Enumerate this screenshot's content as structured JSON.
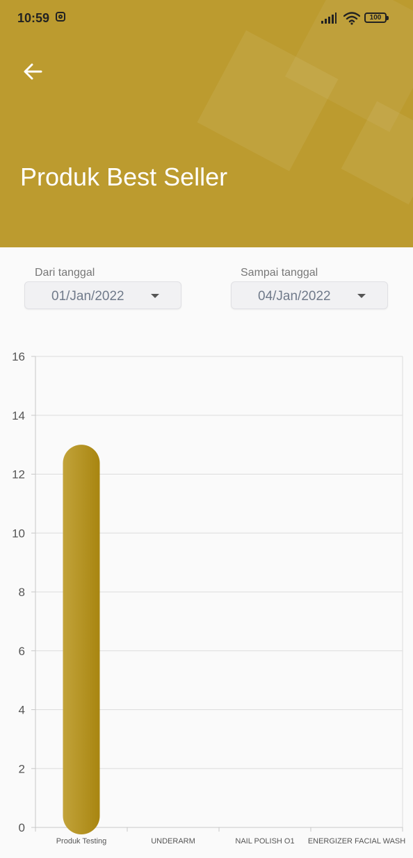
{
  "status_bar": {
    "time": "10:59",
    "battery": "100"
  },
  "header": {
    "title": "Produk Best Seller"
  },
  "filters": {
    "from": {
      "label": "Dari tanggal",
      "value": "01/Jan/2022"
    },
    "to": {
      "label": "Sampai tanggal",
      "value": "04/Jan/2022"
    }
  },
  "colors": {
    "header_bg": "#bc9b2f",
    "bar_start": "#c2a33a",
    "bar_end": "#a88510"
  },
  "chart_data": {
    "type": "bar",
    "categories": [
      "Produk Testing",
      "UNDERARM",
      "NAIL POLISH O1",
      "ENERGIZER FACIAL WASH"
    ],
    "values": [
      13,
      0,
      0,
      0
    ],
    "ylim": [
      0,
      16
    ],
    "yticks": [
      0,
      2,
      4,
      6,
      8,
      10,
      12,
      14,
      16
    ],
    "grid": true,
    "title": "",
    "xlabel": "",
    "ylabel": ""
  }
}
